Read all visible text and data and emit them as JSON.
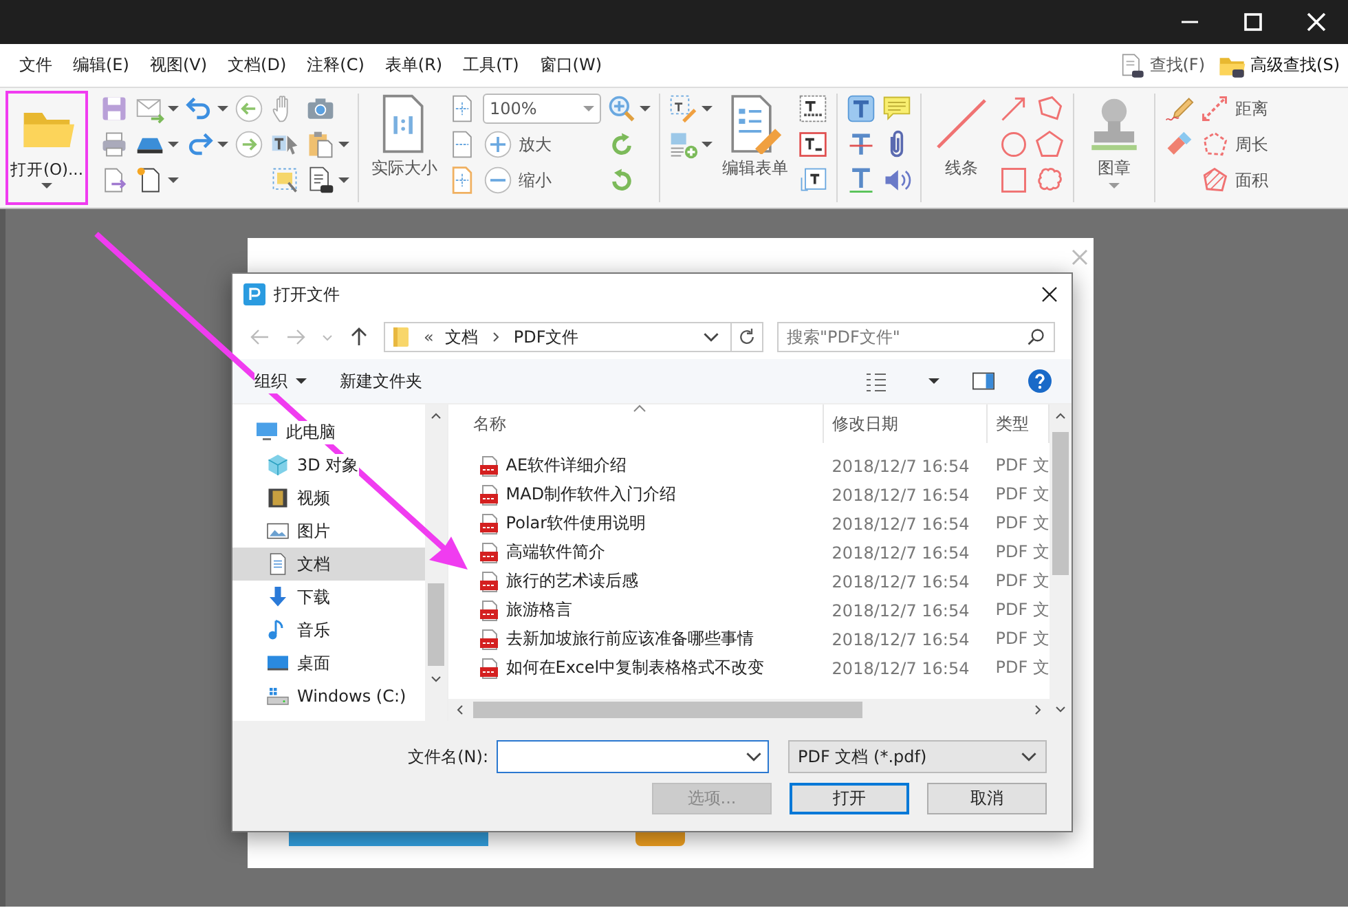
{
  "menu": [
    "文件",
    "编辑(E)",
    "视图(V)",
    "文档(D)",
    "注释(C)",
    "表单(R)",
    "工具(T)",
    "窗口(W)"
  ],
  "menu_right": [
    {
      "label": "查找(F)",
      "kind": "find"
    },
    {
      "label": "高级查找(S)",
      "kind": "advanced"
    }
  ],
  "ribbon": {
    "open": "打开(O)...",
    "zoom_value": "100%",
    "actual_size": "实际大小",
    "zoom_in": "放大",
    "zoom_out": "缩小",
    "edit_form": "编辑表单",
    "line": "线条",
    "stamp": "图章",
    "measure": [
      "距离",
      "周长",
      "面积"
    ]
  },
  "dialog": {
    "title": "打开文件",
    "address": {
      "overflow": "«",
      "path": [
        "文档",
        "PDF文件"
      ]
    },
    "search": {
      "placeholder": "搜索\"PDF文件\""
    },
    "commands": {
      "organize": "组织",
      "new_folder": "新建文件夹"
    },
    "nav": [
      {
        "label": "此电脑",
        "kind": "computer",
        "selected": false,
        "children": [
          {
            "label": "3D 对象",
            "kind": "cube",
            "selected": false
          },
          {
            "label": "视频",
            "kind": "video",
            "selected": false
          },
          {
            "label": "图片",
            "kind": "pictures",
            "selected": false
          },
          {
            "label": "文档",
            "kind": "documents",
            "selected": true
          },
          {
            "label": "下载",
            "kind": "downloads",
            "selected": false
          },
          {
            "label": "音乐",
            "kind": "music",
            "selected": false
          },
          {
            "label": "桌面",
            "kind": "desktop",
            "selected": false
          },
          {
            "label": "Windows (C:)",
            "kind": "drive",
            "selected": false
          }
        ]
      }
    ],
    "columns": [
      "名称",
      "修改日期",
      "类型"
    ],
    "rows": [
      {
        "name": "AE软件详细介绍",
        "date": "2018/12/7 16:54",
        "type": "PDF 文"
      },
      {
        "name": "MAD制作软件入门介绍",
        "date": "2018/12/7 16:54",
        "type": "PDF 文"
      },
      {
        "name": "Polar软件使用说明",
        "date": "2018/12/7 16:54",
        "type": "PDF 文"
      },
      {
        "name": "高端软件简介",
        "date": "2018/12/7 16:54",
        "type": "PDF 文"
      },
      {
        "name": "旅行的艺术读后感",
        "date": "2018/12/7 16:54",
        "type": "PDF 文"
      },
      {
        "name": "旅游格言",
        "date": "2018/12/7 16:54",
        "type": "PDF 文"
      },
      {
        "name": "去新加坡旅行前应该准备哪些事情",
        "date": "2018/12/7 16:54",
        "type": "PDF 文"
      },
      {
        "name": "如何在Excel中复制表格格式不改变",
        "date": "2018/12/7 16:54",
        "type": "PDF 文"
      }
    ],
    "filename": {
      "label": "文件名(N):"
    },
    "filetype": "PDF 文档 (*.pdf)",
    "buttons": [
      {
        "label": "选项...",
        "disabled": true,
        "default": false
      },
      {
        "label": "打开",
        "disabled": false,
        "default": true
      },
      {
        "label": "取消",
        "disabled": false,
        "default": false
      }
    ]
  }
}
